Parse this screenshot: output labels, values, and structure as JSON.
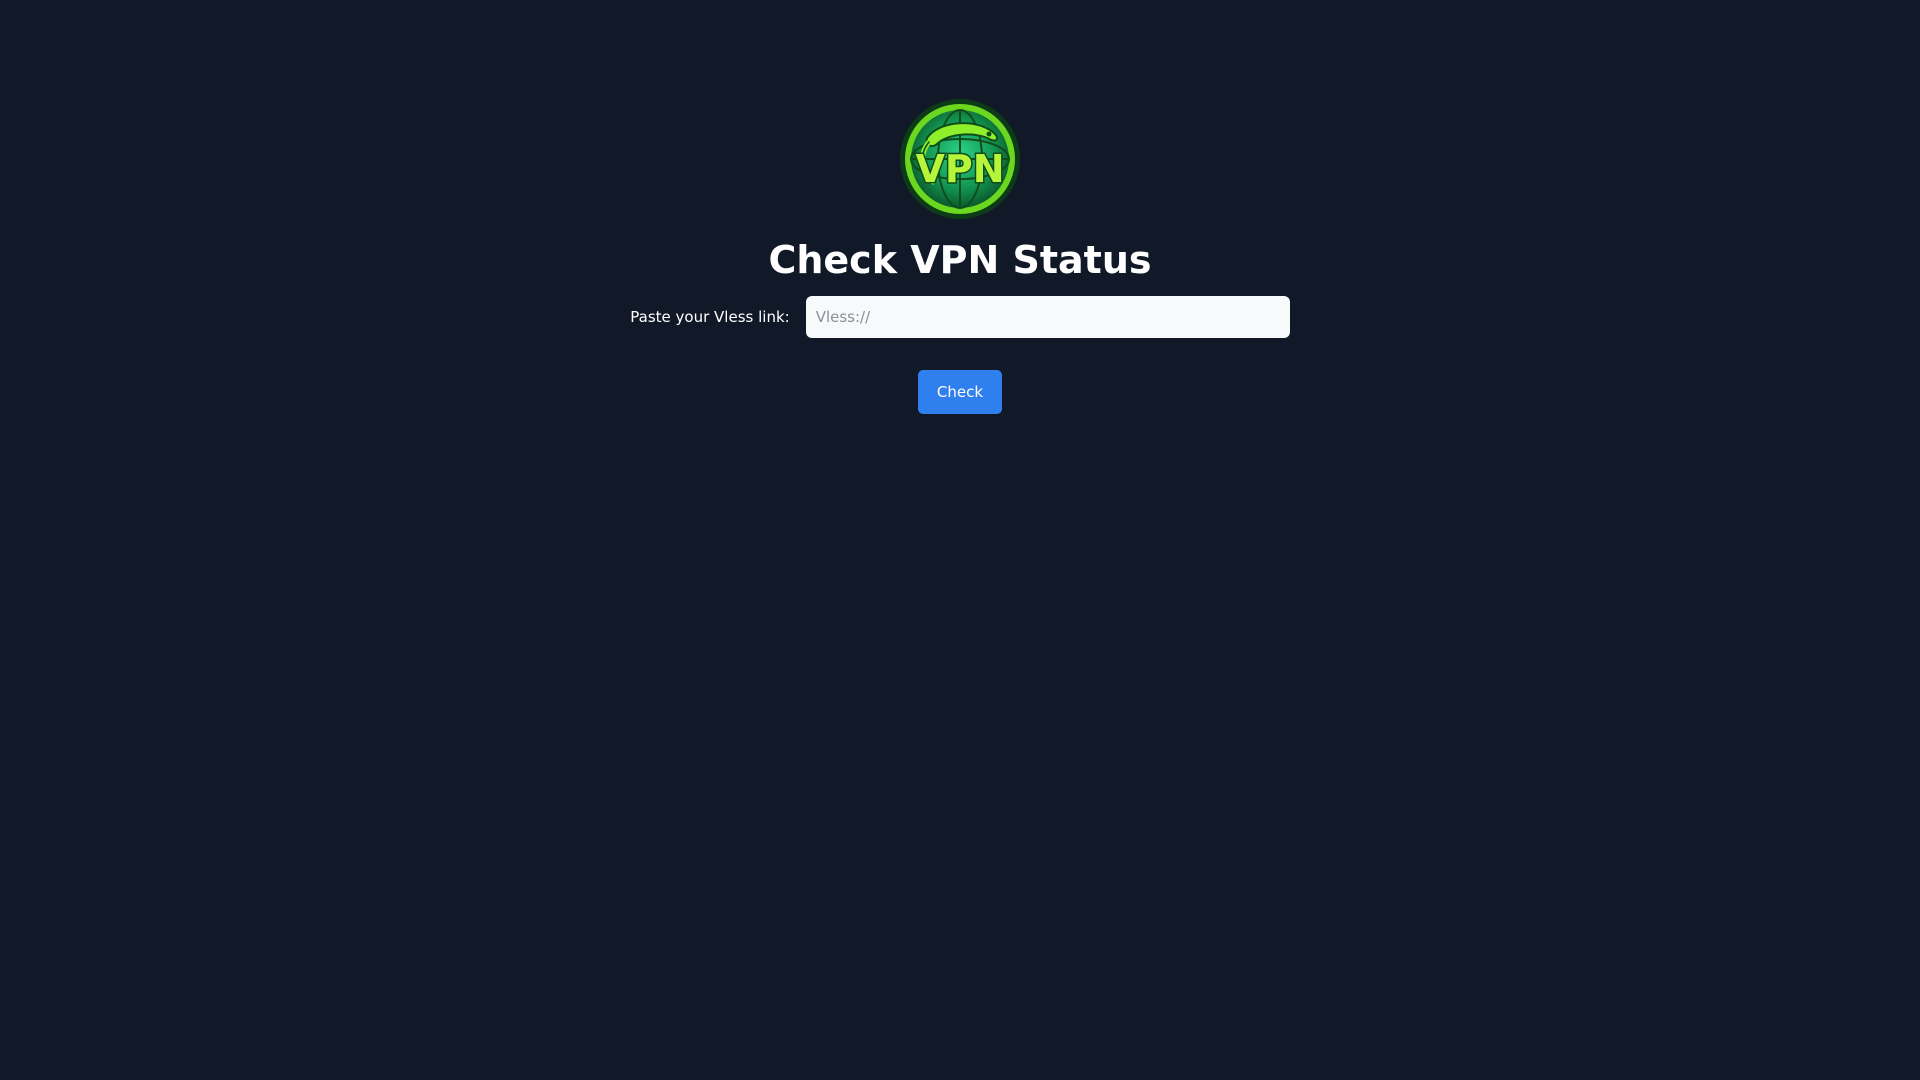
{
  "page": {
    "title": "Check VPN Status"
  },
  "logo": {
    "text": "VPN",
    "icon": "vpn-globe-lizard-logo",
    "colors": {
      "bright_green": "#6bd81f",
      "dark_green": "#0f4d1a",
      "teal": "#1fa66a"
    }
  },
  "form": {
    "label": "Paste your Vless link:",
    "input_value": "",
    "input_placeholder": "Vless://",
    "button_label": "Check"
  },
  "colors": {
    "background": "#111827",
    "button": "#2f7fee",
    "input_bg": "#f8f9fb"
  }
}
